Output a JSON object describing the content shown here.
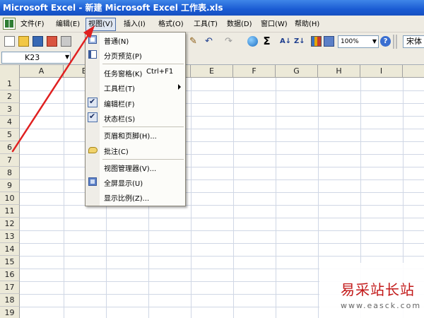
{
  "window": {
    "title": "Microsoft Excel - 新建 Microsoft Excel 工作表.xls"
  },
  "menubar": {
    "items": [
      {
        "label": "文件(F)"
      },
      {
        "label": "编辑(E)"
      },
      {
        "label": "视图(V)",
        "active": true
      },
      {
        "label": "插入(I)"
      },
      {
        "label": "格式(O)"
      },
      {
        "label": "工具(T)"
      },
      {
        "label": "数据(D)"
      },
      {
        "label": "窗口(W)"
      },
      {
        "label": "帮助(H)"
      }
    ]
  },
  "toolbar": {
    "zoom": "100%",
    "font": "宋体",
    "icons": [
      "new-icon",
      "open-icon",
      "save-icon",
      "permission-icon",
      "print-icon",
      "undo-icon",
      "redo-icon",
      "hyperlink-icon",
      "autosum-icon",
      "sort-asc-icon",
      "sort-desc-icon",
      "chart-wizard-icon",
      "drawing-icon",
      "help-icon"
    ]
  },
  "formula_bar": {
    "name_box": "K23"
  },
  "grid": {
    "columns": [
      "A",
      "B",
      "C",
      "D",
      "E",
      "F",
      "G",
      "H",
      "I"
    ],
    "rows": [
      "1",
      "2",
      "3",
      "4",
      "5",
      "6",
      "7",
      "8",
      "9",
      "10",
      "11",
      "12",
      "13",
      "14",
      "15",
      "16",
      "17",
      "18",
      "19"
    ],
    "gridline_color": "#d0d7e5"
  },
  "view_menu": {
    "items": [
      {
        "label": "普通(N)",
        "icon": "normal-view-icon"
      },
      {
        "label": "分页预览(P)",
        "icon": "page-break-preview-icon"
      },
      {
        "label": "任务窗格(K)",
        "shortcut": "Ctrl+F1"
      },
      {
        "label": "工具栏(T)",
        "submenu": true
      },
      {
        "label": "编辑栏(F)",
        "checked": true
      },
      {
        "label": "状态栏(S)",
        "checked": true
      },
      {
        "label": "页眉和页脚(H)..."
      },
      {
        "label": "批注(C)",
        "icon": "comment-icon"
      },
      {
        "label": "视图管理器(V)..."
      },
      {
        "label": "全屏显示(U)",
        "icon": "full-screen-icon"
      },
      {
        "label": "显示比例(Z)..."
      }
    ]
  },
  "annotation": {
    "arrow_color": "#e02020"
  },
  "watermark": {
    "title": "易采站长站",
    "url": "www.easck.com"
  }
}
